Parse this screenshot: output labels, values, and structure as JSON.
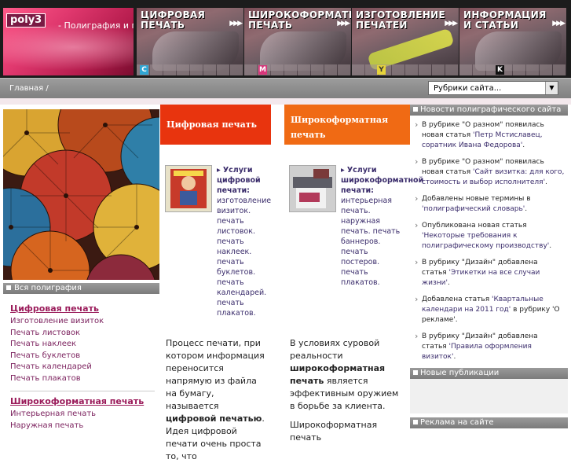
{
  "header": {
    "logo": "poly3",
    "tagline": "- Полиграфия и печать",
    "nav": [
      {
        "label": "Цифровая печать",
        "cmyk": "C",
        "cmyk_color": "#2fa6d4"
      },
      {
        "label": "Широкоформатная печать",
        "cmyk": "M",
        "cmyk_color": "#d8357a"
      },
      {
        "label": "Изготовление печатей",
        "cmyk": "Y",
        "cmyk_color": "#e6d33a"
      },
      {
        "label": "Информация и статьи",
        "cmyk": "K",
        "cmyk_color": "#111111"
      }
    ]
  },
  "breadcrumb": "Главная /",
  "rubrics_select": "Рубрики сайта...",
  "sidebar": {
    "title": "Вся полиграфия",
    "groups": [
      {
        "title": "Цифровая печать",
        "items": [
          "Изготовление визиток",
          "Печать листовок",
          "Печать наклеек",
          "Печать буклетов",
          "Печать календарей",
          "Печать плакатов"
        ]
      },
      {
        "title": "Широкоформатная печать",
        "items": [
          "Интерьерная печать",
          "Наружная печать"
        ]
      }
    ]
  },
  "digital": {
    "title": "Цифровая печать",
    "services_label": "Услуги цифровой печати:",
    "services_text": "изготовление визиток. печать листовок. печать наклеек. печать буклетов. печать календарей. печать плакатов.",
    "para_1": "Процесс печати, при котором информация переносится напрямую из файла на бумагу, называется",
    "para_bold": "цифровой печатью",
    "para_2": ". Идея цифровой печати очень проста то, что"
  },
  "wide": {
    "title": "Широкоформатная печать",
    "services_label": "Услуги широкоформатной печати:",
    "services_text": "интерьерная печать. наружная печать. печать баннеров. печать постеров. печать плакатов.",
    "para_1": "В условиях суровой реальности",
    "para_bold": "широкоформатная печать",
    "para_2": "является эффективным оружием в борьбе за клиента.",
    "para_3": "Широкоформатная печать"
  },
  "news": {
    "title": "Новости полиграфического сайта",
    "items": [
      {
        "pre": "В рубрике \"О разном\" появилась новая статья",
        "q": "'Петр Мстиславец, соратник Ивана Федорова'",
        "post": "."
      },
      {
        "pre": "В рубрике \"О разном\" появилась новая статья",
        "q": "'Сайт визитка: для кого, стоимость и выбор исполнителя'",
        "post": "."
      },
      {
        "pre": "Добавлены новые термины в",
        "q": "'полиграфический словарь'",
        "post": "."
      },
      {
        "pre": "Опубликована новая статья",
        "q": "'Некоторые требования к полиграфическому производству'",
        "post": "."
      },
      {
        "pre": "В рубрику \"Дизайн\" добавлена статья",
        "q": "'Этикетки на все случаи жизни'",
        "post": "."
      },
      {
        "pre": "Добавлена статья",
        "q": "'Квартальные календари на 2011 год'",
        "post": " в рубрику 'О рекламе'."
      },
      {
        "pre": "В рубрику \"Дизайн\" добавлена статья",
        "q": "'Правила оформления визиток'",
        "post": "."
      }
    ]
  },
  "publications_title": "Новые публикации",
  "ads_title": "Реклама на сайте",
  "colors": {
    "digital_header": "#e8340e",
    "wide_header": "#f06a14",
    "link": "#7a1f5c"
  }
}
